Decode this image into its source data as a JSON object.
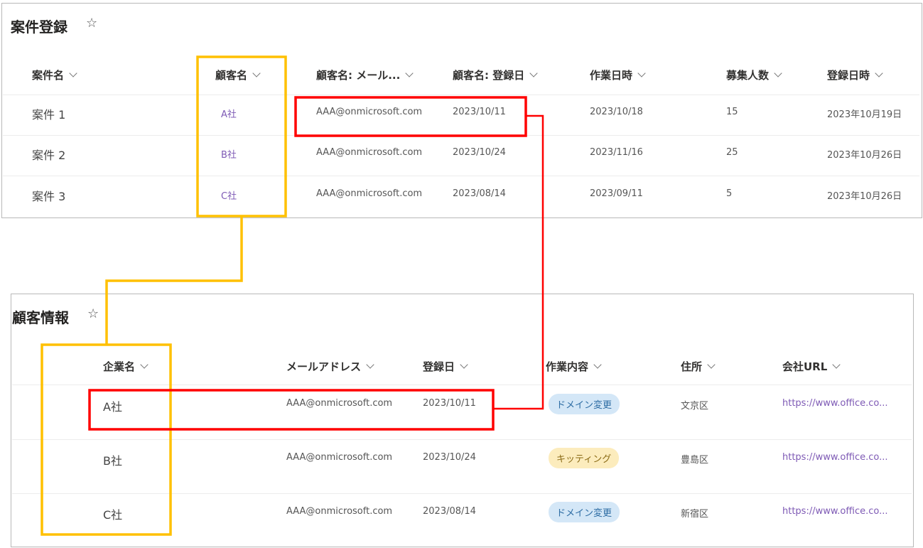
{
  "top": {
    "title": "案件登録",
    "star": "☆",
    "columns": [
      "案件名",
      "顧客名",
      "顧客名: メール...",
      "顧客名: 登録日",
      "作業日時",
      "募集人数",
      "登録日時"
    ],
    "rows": [
      {
        "name": "案件 1",
        "customer": "A社",
        "email": "AAA@onmicrosoft.com",
        "reg": "2023/10/11",
        "work": "2023/10/18",
        "count": "15",
        "created": "2023年10月19日"
      },
      {
        "name": "案件 2",
        "customer": "B社",
        "email": "AAA@onmicrosoft.com",
        "reg": "2023/10/24",
        "work": "2023/11/16",
        "count": "25",
        "created": "2023年10月26日"
      },
      {
        "name": "案件 3",
        "customer": "C社",
        "email": "AAA@onmicrosoft.com",
        "reg": "2023/08/14",
        "work": "2023/09/11",
        "count": "5",
        "created": "2023年10月26日"
      }
    ]
  },
  "bottom": {
    "title": "顧客情報",
    "star": "☆",
    "columns": [
      "企業名",
      "メールアドレス",
      "登録日",
      "作業内容",
      "住所",
      "会社URL"
    ],
    "rows": [
      {
        "company": "A社",
        "email": "AAA@onmicrosoft.com",
        "reg": "2023/10/11",
        "task": "ドメイン変更",
        "task_color": "blue",
        "addr": "文京区",
        "url": "https://www.office.co..."
      },
      {
        "company": "B社",
        "email": "AAA@onmicrosoft.com",
        "reg": "2023/10/24",
        "task": "キッティング",
        "task_color": "yellow",
        "addr": "豊島区",
        "url": "https://www.office.co..."
      },
      {
        "company": "C社",
        "email": "AAA@onmicrosoft.com",
        "reg": "2023/08/14",
        "task": "ドメイン変更",
        "task_color": "blue",
        "addr": "新宿区",
        "url": "https://www.office.co..."
      }
    ]
  },
  "colors": {
    "annotation_yellow": "#ffc000",
    "annotation_red": "#ff0000",
    "pill_blue": "#d4e7f7",
    "pill_yellow": "#fcecbd",
    "link": "#7e5ab5"
  }
}
